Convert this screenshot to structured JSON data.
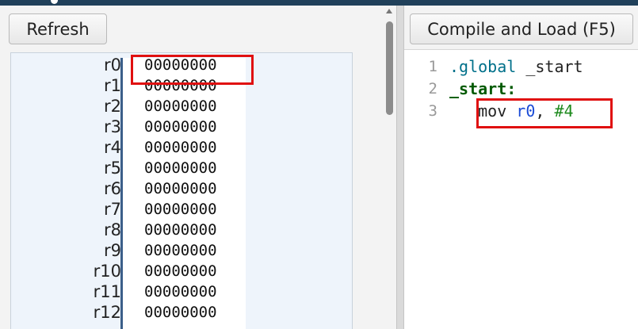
{
  "toolbar": {
    "refresh_label": "Refresh",
    "compile_label": "Compile and Load (F5)"
  },
  "registers": [
    {
      "name": "r0",
      "value": "00000000"
    },
    {
      "name": "r1",
      "value": "00000000"
    },
    {
      "name": "r2",
      "value": "00000000"
    },
    {
      "name": "r3",
      "value": "00000000"
    },
    {
      "name": "r4",
      "value": "00000000"
    },
    {
      "name": "r5",
      "value": "00000000"
    },
    {
      "name": "r6",
      "value": "00000000"
    },
    {
      "name": "r7",
      "value": "00000000"
    },
    {
      "name": "r8",
      "value": "00000000"
    },
    {
      "name": "r9",
      "value": "00000000"
    },
    {
      "name": "r10",
      "value": "00000000"
    },
    {
      "name": "r11",
      "value": "00000000"
    },
    {
      "name": "r12",
      "value": "00000000"
    }
  ],
  "editor": {
    "line_numbers": [
      "1",
      "2",
      "3"
    ],
    "line1": {
      "directive": ".global",
      "symbol": " _start"
    },
    "line2": {
      "label": "_start:"
    },
    "line3": {
      "indent": "   ",
      "mnemonic": "mov",
      "register": "r0",
      "separator": ", ",
      "immediate": "#4"
    }
  },
  "colors": {
    "highlight": "#e01010",
    "register_divider": "#3c5f8a",
    "directive": "#00708a",
    "label": "#005a00",
    "register_token": "#1a4bd6",
    "immediate_token": "#1d8a1d",
    "title_bar": "#20405a"
  }
}
